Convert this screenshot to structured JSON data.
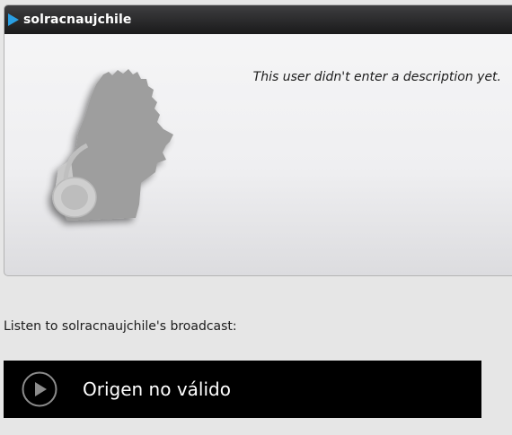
{
  "profile": {
    "username": "solracnaujchile",
    "description": "This user didn't enter a description yet.",
    "avatar_icon": "user-silhouette-headphones-icon",
    "accent_color": "#2a9fe3"
  },
  "broadcast": {
    "listen_label": "Listen to solracnaujchile's broadcast:",
    "player_message": "Origen no válido",
    "play_icon": "play-circle-icon"
  }
}
